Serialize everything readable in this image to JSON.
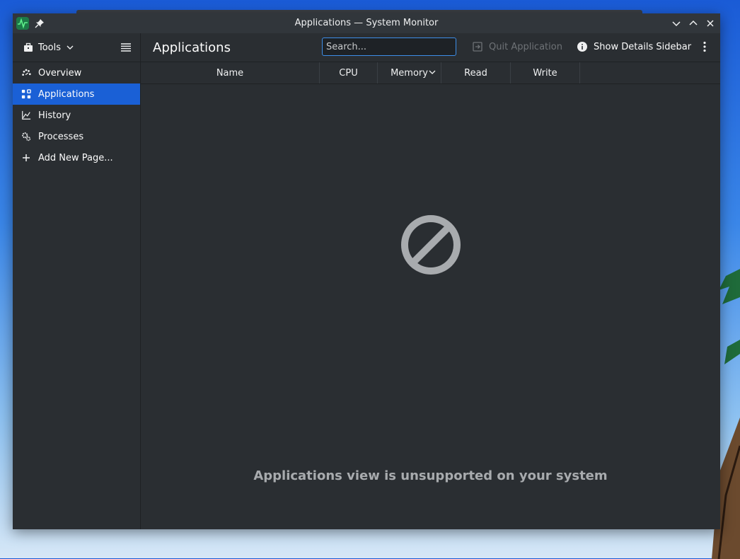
{
  "window": {
    "title": "Applications — System Monitor"
  },
  "sidebar": {
    "tools_label": "Tools",
    "items": [
      {
        "label": "Overview",
        "icon": "overview-icon",
        "active": false
      },
      {
        "label": "Applications",
        "icon": "applications-icon",
        "active": true
      },
      {
        "label": "History",
        "icon": "history-chart-icon",
        "active": false
      },
      {
        "label": "Processes",
        "icon": "processes-gear-icon",
        "active": false
      },
      {
        "label": "Add New Page...",
        "icon": "plus-icon",
        "active": false
      }
    ]
  },
  "toolbar": {
    "page_title": "Applications",
    "search_placeholder": "Search...",
    "quit_label": "Quit Application",
    "details_label": "Show Details Sidebar"
  },
  "table": {
    "columns": [
      "Name",
      "CPU",
      "Memory",
      "Read",
      "Write"
    ],
    "sorted_column": "Memory"
  },
  "content": {
    "empty_message": "Applications view is unsupported on your system"
  },
  "colors": {
    "accent": "#1a60d6",
    "focus_border": "#3d8ee8",
    "background": "#2a2e32"
  }
}
